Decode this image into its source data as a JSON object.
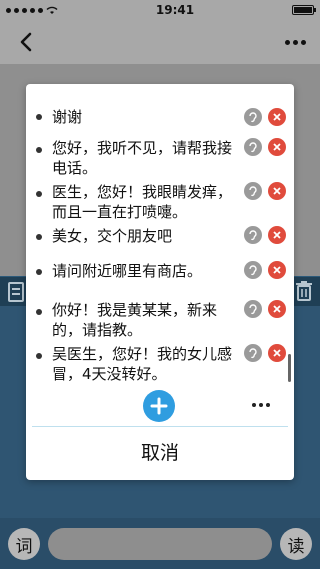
{
  "status_bar": {
    "time": "19:41"
  },
  "bottom_bar": {
    "left_button": "词",
    "right_button": "读"
  },
  "modal": {
    "phrases": [
      {
        "text": "谢谢"
      },
      {
        "text": "您好，我听不见，请帮我接电话。"
      },
      {
        "text": "医生，您好！我眼睛发痒，而且一直在打喷嚏。"
      },
      {
        "text": "美女，交个朋友吧"
      },
      {
        "text": "请问附近哪里有商店。"
      },
      {
        "text": "你好！我是黄某某，新来的，请指教。"
      },
      {
        "text": "吴医生，您好！我的女儿感冒，4天没转好。"
      }
    ],
    "cancel_label": "取消"
  },
  "colors": {
    "add_button": "#2f9de0",
    "delete": "#e04b3c",
    "listen": "#9a9a9a"
  },
  "icons": {
    "back": "chevron-left-icon",
    "more": "more-dots-icon",
    "listen": "ear-icon",
    "delete": "close-icon",
    "add": "plus-icon"
  }
}
